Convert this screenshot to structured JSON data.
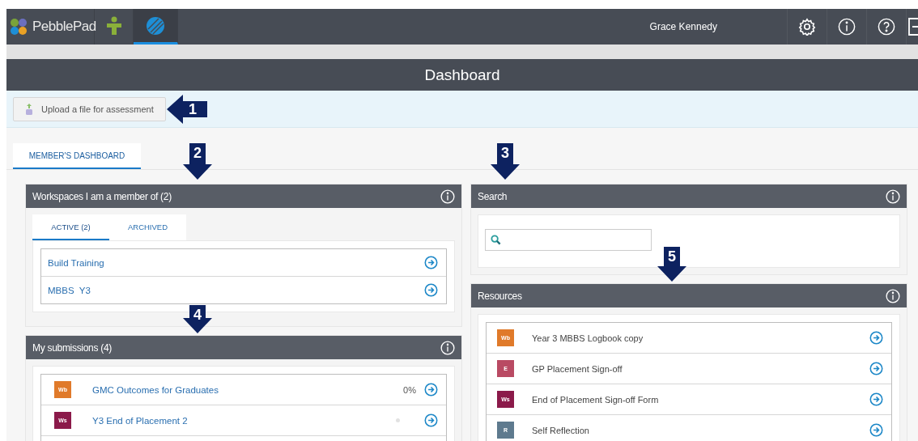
{
  "topbar": {
    "brand": "PebblePad",
    "apps": [
      {
        "kind": "person",
        "selected": false
      },
      {
        "kind": "globe",
        "selected": true
      }
    ],
    "user": "Grace Kennedy"
  },
  "page": {
    "title": "Dashboard",
    "upload_button": "Upload a file for assessment",
    "tabs": [
      {
        "label": "MEMBER'S DASHBOARD",
        "selected": true
      }
    ]
  },
  "workspaces": {
    "title": "Workspaces I am a member of (2)",
    "tabs": [
      {
        "label": "ACTIVE (2)",
        "selected": true
      },
      {
        "label": "ARCHIVED",
        "selected": false
      }
    ],
    "items": [
      "Build Training",
      "MBBS  Y3"
    ]
  },
  "submissions": {
    "title": "My submissions (4)",
    "items": [
      {
        "badge": "Wb",
        "color": "#e07a2a",
        "name": "GMC Outcomes for Graduates",
        "kind": "percent",
        "progress": "0%"
      },
      {
        "badge": "Ws",
        "color": "#8b1a4a",
        "name": "Y3 End of Placement 2",
        "kind": "dot"
      }
    ]
  },
  "search": {
    "title": "Search"
  },
  "resources": {
    "title": "Resources",
    "items": [
      {
        "badge": "Wb",
        "color": "#e07a2a",
        "name": "Year 3 MBBS Logbook copy"
      },
      {
        "badge": "E",
        "color": "#b94a63",
        "name": "GP Placement Sign-off"
      },
      {
        "badge": "Ws",
        "color": "#8b1a4a",
        "name": "End of Placement Sign-off Form"
      },
      {
        "badge": "R",
        "color": "#5e7a8e",
        "name": "Self Reflection"
      }
    ]
  },
  "callouts": [
    {
      "number": "1",
      "kind": "left"
    },
    {
      "number": "2",
      "kind": "down"
    },
    {
      "number": "3",
      "kind": "down"
    },
    {
      "number": "4",
      "kind": "down"
    },
    {
      "number": "5",
      "kind": "down"
    }
  ]
}
